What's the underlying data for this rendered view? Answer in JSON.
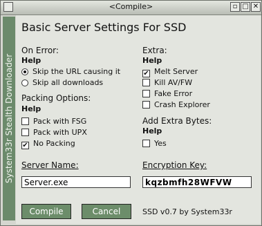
{
  "window": {
    "title": "<Compile>",
    "system_button": "",
    "min_button": "▫",
    "max_button": "□",
    "close_button": "✕"
  },
  "sidebar": {
    "text": "System33r Stealth Downloader"
  },
  "heading": "Basic Server Settings For SSD",
  "on_error": {
    "label": "On Error:",
    "help": "Help",
    "options": [
      {
        "label": "Skip the URL causing it",
        "selected": true
      },
      {
        "label": "Skip all downloads",
        "selected": false
      }
    ]
  },
  "packing": {
    "label": "Packing Options:",
    "help": "Help",
    "options": [
      {
        "label": "Pack with FSG",
        "checked": false
      },
      {
        "label": "Pack with UPX",
        "checked": false
      },
      {
        "label": "No Packing",
        "checked": true
      }
    ]
  },
  "extra": {
    "label": "Extra:",
    "help": "Help",
    "options": [
      {
        "label": "Melt Server",
        "checked": true
      },
      {
        "label": "Kill AV/FW",
        "checked": false
      },
      {
        "label": "Fake Error",
        "checked": false
      },
      {
        "label": "Crash Explorer",
        "checked": false
      }
    ]
  },
  "extra_bytes": {
    "label": "Add Extra Bytes:",
    "help": "Help",
    "option": {
      "label": "Yes",
      "checked": false
    }
  },
  "server_name": {
    "label": "Server Name:",
    "value": "Server.exe"
  },
  "encryption_key": {
    "label": "Encryption Key:",
    "value": "kqzbmfh28WFVW"
  },
  "buttons": {
    "compile": "Compile",
    "cancel": "Cancel"
  },
  "footer": "SSD v0.7 by System33r",
  "colors": {
    "accent": "#6c8d6a",
    "sidebar": "#6b8a6b"
  }
}
